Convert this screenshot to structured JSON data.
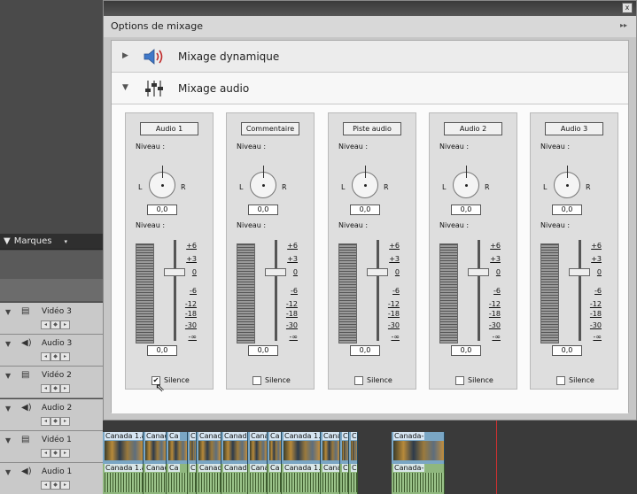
{
  "dialog": {
    "title": "Options de mixage",
    "menu_glyph": "▸▸",
    "close_glyph": "x"
  },
  "sections": {
    "dynamic_mix": {
      "label": "Mixage dynamique",
      "arrow": "▶",
      "icon": "speaker-icon"
    },
    "audio_mix": {
      "label": "Mixage audio",
      "arrow": "▼",
      "icon": "mixer-sliders-icon"
    }
  },
  "channels": [
    {
      "name": "Audio 1",
      "niveau1": "Niveau :",
      "pan_l": "L",
      "pan_r": "R",
      "pan_value": "0,0",
      "niveau2": "Niveau :",
      "volume_value": "0,0",
      "silence_label": "Silence",
      "silence_checked": true
    },
    {
      "name": "Commentaire",
      "niveau1": "Niveau :",
      "pan_l": "L",
      "pan_r": "R",
      "pan_value": "0,0",
      "niveau2": "Niveau :",
      "volume_value": "0,0",
      "silence_label": "Silence",
      "silence_checked": false
    },
    {
      "name": "Piste audio",
      "niveau1": "Niveau :",
      "pan_l": "L",
      "pan_r": "R",
      "pan_value": "0,0",
      "niveau2": "Niveau :",
      "volume_value": "0,0",
      "silence_label": "Silence",
      "silence_checked": false
    },
    {
      "name": "Audio 2",
      "niveau1": "Niveau :",
      "pan_l": "L",
      "pan_r": "R",
      "pan_value": "0,0",
      "niveau2": "Niveau :",
      "volume_value": "0,0",
      "silence_label": "Silence",
      "silence_checked": false
    },
    {
      "name": "Audio 3",
      "niveau1": "Niveau :",
      "pan_l": "L",
      "pan_r": "R",
      "pan_value": "0,0",
      "niveau2": "Niveau :",
      "volume_value": "0,0",
      "silence_label": "Silence",
      "silence_checked": false
    }
  ],
  "scale_labels": [
    "+6",
    "+3",
    "0",
    "-6",
    "-12",
    "-18",
    "-30",
    "-∞"
  ],
  "check_glyph": "✔",
  "background": {
    "marques_label": "Marques",
    "tracks": [
      {
        "name": "Vidéo 3",
        "kind": "video"
      },
      {
        "name": "Audio 3",
        "kind": "audio"
      },
      {
        "name": "Vidéo 2",
        "kind": "video"
      },
      {
        "name": "Audio 2",
        "kind": "audio"
      },
      {
        "name": "Vidéo 1",
        "kind": "video"
      },
      {
        "name": "Audio 1",
        "kind": "audio"
      }
    ],
    "clips": [
      "Canada 1.a",
      "Canad",
      "Ca",
      "C.",
      "Canad",
      "Canada",
      "Cana",
      "Ca",
      "Canada 1.a",
      "Cana",
      "C.",
      "C.",
      "Canada-"
    ]
  }
}
